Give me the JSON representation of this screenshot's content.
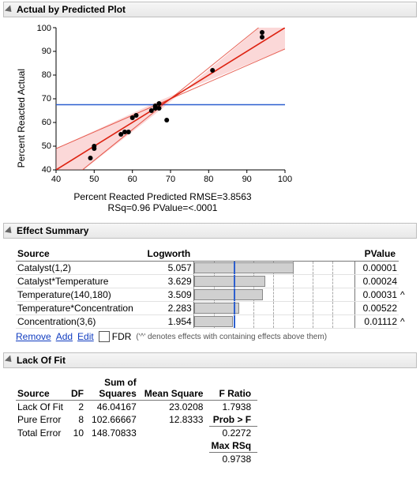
{
  "chart_data": [
    {
      "type": "scatter",
      "title": "Actual by Predicted Plot",
      "xlabel": "Percent Reacted Predicted RMSE=3.8563",
      "subtitle": "RSq=0.96 PValue=<.0001",
      "ylabel": "Percent Reacted Actual",
      "xlim": [
        40,
        100
      ],
      "ylim": [
        40,
        100
      ],
      "hline_y": 67.5,
      "fit_line": {
        "slope": 1.0,
        "intercept": 0.0
      },
      "points": [
        {
          "x": 49,
          "y": 45
        },
        {
          "x": 50,
          "y": 49
        },
        {
          "x": 50,
          "y": 50
        },
        {
          "x": 57,
          "y": 55
        },
        {
          "x": 58,
          "y": 56
        },
        {
          "x": 59,
          "y": 56
        },
        {
          "x": 60,
          "y": 62
        },
        {
          "x": 61,
          "y": 63
        },
        {
          "x": 65,
          "y": 65
        },
        {
          "x": 66,
          "y": 66
        },
        {
          "x": 66,
          "y": 67
        },
        {
          "x": 67,
          "y": 66
        },
        {
          "x": 67,
          "y": 68
        },
        {
          "x": 69,
          "y": 61
        },
        {
          "x": 81,
          "y": 82
        },
        {
          "x": 94,
          "y": 96
        },
        {
          "x": 94,
          "y": 98
        }
      ],
      "conf_band_half_width_at_ends": 9,
      "conf_band_half_width_at_center": 2
    },
    {
      "type": "bar",
      "title": "Effect Summary Logworth",
      "categories": [
        "Catalyst(1,2)",
        "Catalyst*Temperature",
        "Temperature(140,180)",
        "Temperature*Concentration",
        "Concentration(3,6)"
      ],
      "values": [
        5.057,
        3.629,
        3.509,
        2.283,
        1.954
      ],
      "xlim": [
        0,
        8
      ],
      "reference_line_x": 2.0
    }
  ],
  "sections": {
    "plot_title": "Actual by Predicted Plot",
    "effect_title": "Effect Summary",
    "lof_title": "Lack Of Fit"
  },
  "plot": {
    "ylabel": "Percent Reacted Actual",
    "xlabel": "Percent Reacted Predicted RMSE=3.8563",
    "stats": "RSq=0.96 PValue=<.0001",
    "xticks": [
      "40",
      "50",
      "60",
      "70",
      "80",
      "90",
      "100"
    ],
    "yticks": [
      "40",
      "50",
      "60",
      "70",
      "80",
      "90",
      "100"
    ]
  },
  "effects": {
    "col_source": "Source",
    "col_logworth": "Logworth",
    "col_pvalue": "PValue",
    "rows": [
      {
        "source": "Catalyst(1,2)",
        "logworth": "5.057",
        "pvalue": "0.00001",
        "caret": ""
      },
      {
        "source": "Catalyst*Temperature",
        "logworth": "3.629",
        "pvalue": "0.00024",
        "caret": ""
      },
      {
        "source": "Temperature(140,180)",
        "logworth": "3.509",
        "pvalue": "0.00031",
        "caret": "^"
      },
      {
        "source": "Temperature*Concentration",
        "logworth": "2.283",
        "pvalue": "0.00522",
        "caret": ""
      },
      {
        "source": "Concentration(3,6)",
        "logworth": "1.954",
        "pvalue": "0.01112",
        "caret": "^"
      }
    ],
    "action_remove": "Remove",
    "action_add": "Add",
    "action_edit": "Edit",
    "fdr_label": "FDR",
    "caret_note": "('^' denotes effects with containing effects above them)"
  },
  "lof": {
    "col_source": "Source",
    "col_df": "DF",
    "col_ss_l1": "Sum of",
    "col_ss_l2": "Squares",
    "col_ms": "Mean Square",
    "col_fr": "F Ratio",
    "rows": [
      {
        "source": "Lack Of Fit",
        "df": "2",
        "ss": "46.04167",
        "ms": "23.0208",
        "fr": "1.7938"
      },
      {
        "source": "Pure Error",
        "df": "8",
        "ss": "102.66667",
        "ms": "12.8333",
        "fr_label": "Prob > F"
      },
      {
        "source": "Total Error",
        "df": "10",
        "ss": "148.70833",
        "ms": "",
        "fr": "0.2272"
      }
    ],
    "maxrsq_label": "Max RSq",
    "maxrsq_value": "0.9738"
  }
}
